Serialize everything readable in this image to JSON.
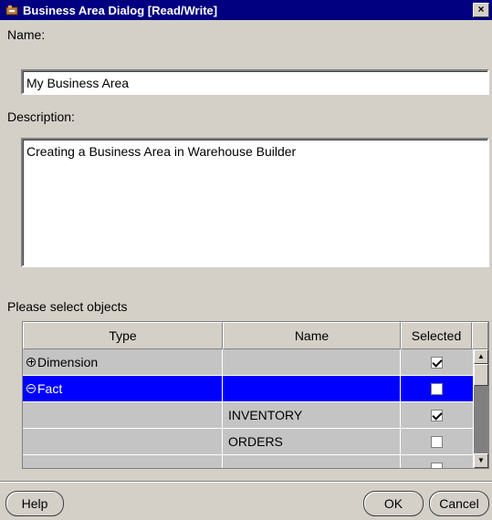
{
  "window": {
    "title": "Business Area Dialog  [Read/Write]",
    "close_label": "×"
  },
  "name_field": {
    "label": "Name:",
    "value": "My Business Area"
  },
  "description_field": {
    "label": "Description:",
    "value": "Creating a Business Area in Warehouse Builder"
  },
  "objects": {
    "label": "Please select objects",
    "columns": [
      "Type",
      "Name",
      "Selected"
    ],
    "rows": [
      {
        "type": "Dimension",
        "name": "",
        "selected": true,
        "tree": "plus"
      },
      {
        "type": "Fact",
        "name": "",
        "selected": false,
        "tree": "minus",
        "highlighted": true
      },
      {
        "type": "",
        "name": "INVENTORY",
        "selected": true
      },
      {
        "type": "",
        "name": "ORDERS",
        "selected": false
      }
    ]
  },
  "buttons": {
    "help": "Help",
    "ok": "OK",
    "cancel": "Cancel"
  },
  "colors": {
    "title_bar": "#000080",
    "selection": "#0000ff",
    "dialog_bg": "#d4d0c8"
  }
}
